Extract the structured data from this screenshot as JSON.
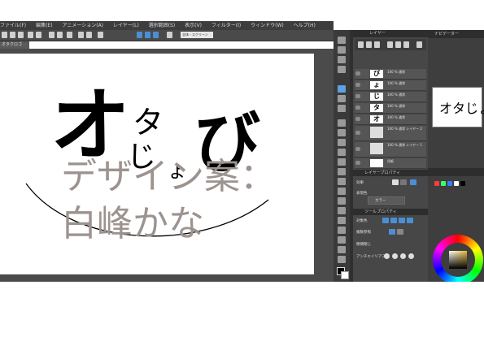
{
  "menu": [
    "ファイル(F)",
    "編集(E)",
    "アニメーション(A)",
    "レイヤー(L)",
    "選択範囲(S)",
    "表示(V)",
    "フィルター(I)",
    "ウィンドウ(W)",
    "ヘルプ(H)"
  ],
  "zoom_field": "全体・スクリーン",
  "document_tab": "オタクロゴ",
  "canvas": {
    "logo_chars": [
      "オ",
      "タ",
      "じ",
      "ょ",
      "び"
    ],
    "overlay_line1": "デザイン案：",
    "overlay_line2": "白峰かな"
  },
  "layers_panel": {
    "title": "レイヤー",
    "rows": [
      {
        "thumb": "び",
        "name": "100 % 通常"
      },
      {
        "thumb": "ょ",
        "name": "100 % 通常"
      },
      {
        "thumb": "じ",
        "name": "100 % 通常"
      },
      {
        "thumb": "タ",
        "name": "100 % 通常"
      },
      {
        "thumb": "オ",
        "name": "100 % 通常"
      },
      {
        "thumb": "",
        "name": "100 % 通常 レイヤー 2"
      },
      {
        "thumb": "",
        "name": "100 % 通常 レイヤー 1"
      },
      {
        "thumb": "",
        "name": "用紙"
      }
    ],
    "property_title": "レイヤープロパティ",
    "effect_label": "効果",
    "color_label": "表現色",
    "color_value": "カラー",
    "tool_property_title": "ツールプロパティ",
    "tool_row1": "対象色",
    "tool_row2": "複数参照",
    "tool_row3": "隙間閉じ",
    "tool_row4": "アンチエイリアス"
  },
  "navigator": {
    "title": "ナビゲーター",
    "preview_text": "オタじょび"
  },
  "colors": {
    "menubar": "#3d3d3d",
    "panel": "#474747",
    "accent": "#4a8fd6",
    "overlay_text": "#9c938f"
  }
}
